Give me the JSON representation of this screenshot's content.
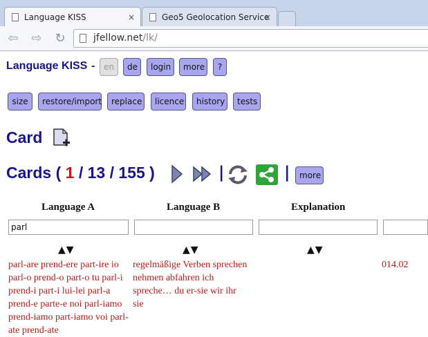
{
  "browser": {
    "tabs": [
      {
        "title": "Language KISS",
        "close": "×"
      },
      {
        "title": "Geo5 Geolocation Service",
        "close": "×"
      }
    ],
    "back": "⇦",
    "forward": "⇨",
    "reload": "↻",
    "url_host": "jfellow.net",
    "url_path": "/lk/"
  },
  "page": {
    "app_title": "Language KISS",
    "dash": "-",
    "lang_buttons": [
      "en",
      "de"
    ],
    "top_buttons": [
      "login",
      "more",
      "?"
    ],
    "tool_buttons": [
      "size",
      "restore/import",
      "replace",
      "licence",
      "history",
      "tests"
    ],
    "card_heading": "Card",
    "cards_prefix": "Cards (",
    "cards_current": "1",
    "cards_sep1": "/ 13 / 155 )",
    "cards_sep": "|",
    "more_button": "more",
    "columns": [
      "Language A",
      "Language B",
      "Explanation"
    ],
    "search_values": [
      "parl",
      "",
      "",
      ""
    ],
    "sort_arrows": "▲▼",
    "row": {
      "col_a": "parl-are prend-ere part-ire io parl-o prend-o part-o tu parl-i prend-i part-i lui-lei parl-a prend-e parte-e noi parl-iamo prend-iamo part-iamo voi parl-ate prend-ate",
      "col_b": "regelmäßige Verben sprechen nehmen abfahren ich spreche… du er-sie wir ihr sie",
      "col_d": "014.02"
    }
  },
  "colors": {
    "heading": "#17148c",
    "button_bg": "#a9a6f0",
    "row_text": "#c01818",
    "accent_red": "#c01818"
  }
}
